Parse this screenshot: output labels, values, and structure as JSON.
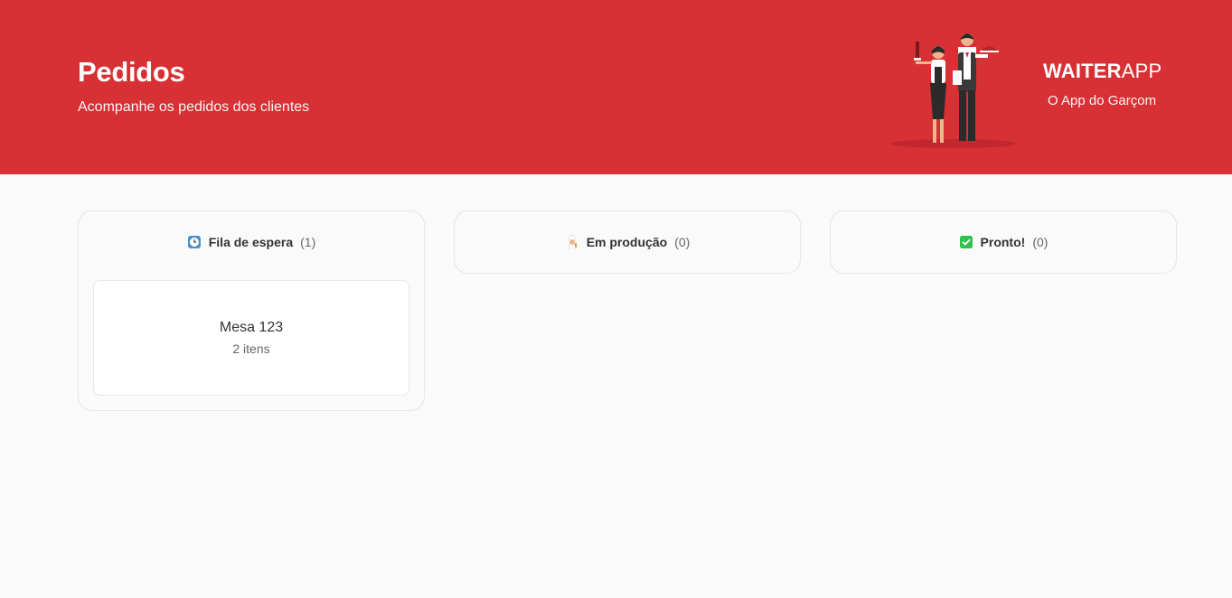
{
  "header": {
    "title": "Pedidos",
    "subtitle": "Acompanhe os pedidos dos clientes",
    "brand_bold": "WAITER",
    "brand_light": "APP",
    "brand_tagline": "O App do Garçom"
  },
  "columns": [
    {
      "icon": "clock-icon",
      "title": "Fila de espera",
      "count": "(1)",
      "orders": [
        {
          "table": "Mesa 123",
          "items": "2 itens"
        }
      ]
    },
    {
      "icon": "chef-icon",
      "title": "Em produção",
      "count": "(0)",
      "orders": []
    },
    {
      "icon": "check-icon",
      "title": "Pronto!",
      "count": "(0)",
      "orders": []
    }
  ],
  "colors": {
    "brand_red": "#d73035",
    "background": "#fafafa",
    "check_green": "#30c04f"
  }
}
